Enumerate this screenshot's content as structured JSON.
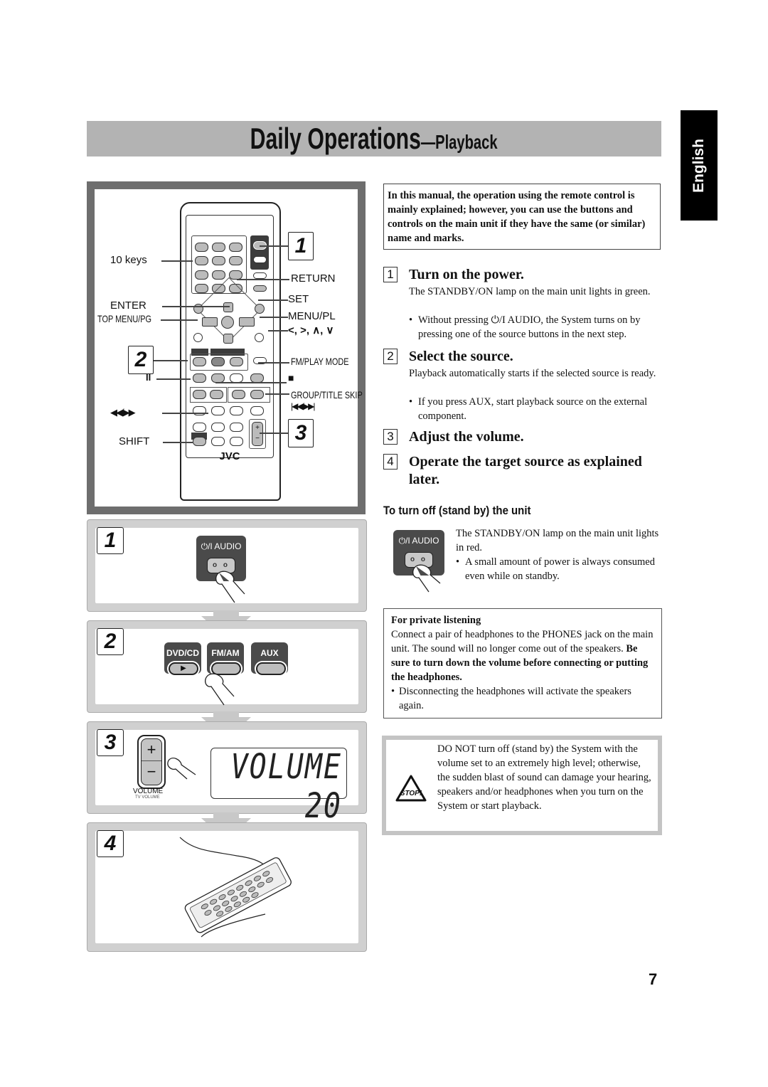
{
  "header": {
    "title_main": "Daily Operations",
    "title_dash": "—",
    "title_sub": "Playback",
    "language_tab": "English"
  },
  "remote_diagram": {
    "brand": "JVC",
    "callouts": {
      "ten_keys": "10 keys",
      "enter": "ENTER",
      "top_menu": "TOP MENU/PG",
      "return": "RETURN",
      "set": "SET",
      "menu_pl": "MENU/PL",
      "cursor": "<, >, ∧, ∨",
      "fm_play_mode": "FM/PLAY MODE",
      "pause": "II",
      "stop": "■",
      "group_title_skip": "GROUP/TITLE SKIP",
      "skip": "|◀◀/▶▶|",
      "search": "◀◀/▶▶",
      "shift": "SHIFT"
    },
    "step_markers": [
      "1",
      "2",
      "3"
    ]
  },
  "step_panels": [
    {
      "number": "1",
      "key_label": "⏻/I AUDIO"
    },
    {
      "number": "2",
      "keys": [
        "DVD/CD",
        "FM/AM",
        "AUX"
      ],
      "play_glyph": "▶"
    },
    {
      "number": "3",
      "volume_label": "VOLUME",
      "tv_volume_label": "TV VOLUME",
      "plus": "+",
      "minus": "−",
      "display_text": "VOLUME 20"
    },
    {
      "number": "4"
    }
  ],
  "intro_note": "In this manual, the operation using the remote control is mainly explained; however, you can use the buttons and controls on the main unit if they have the same (or similar) name and marks.",
  "steps": [
    {
      "number": "1",
      "heading": "Turn on the power.",
      "body": "The STANDBY/ON lamp on the main unit lights in green.",
      "bullets": [
        "Without pressing ⏻/I AUDIO, the System turns on by pressing one of the source buttons in the next step."
      ]
    },
    {
      "number": "2",
      "heading": "Select the source.",
      "body": "Playback automatically starts if the selected source is ready.",
      "bullets": [
        "If you press AUX, start playback source on the external component."
      ]
    },
    {
      "number": "3",
      "heading": "Adjust the volume."
    },
    {
      "number": "4",
      "heading": "Operate the target source as explained later."
    }
  ],
  "turn_off": {
    "heading": "To turn off (stand by) the unit",
    "key_label": "⏻/I AUDIO",
    "body": "The STANDBY/ON lamp on the main unit lights in red.",
    "bullets": [
      "A small amount of power is always consumed even while on standby."
    ]
  },
  "private_listening": {
    "heading": "For private listening",
    "body": "Connect a pair of headphones to the PHONES jack on the main unit. The sound will no longer come out of the speakers.",
    "body_bold": "Be sure to turn down the volume before connecting or putting the headphones.",
    "bullets": [
      "Disconnecting the headphones will activate the speakers again."
    ]
  },
  "caution": {
    "icon_label": "STOP!",
    "text": "DO NOT turn off (stand by) the System with the volume set to an extremely high level; otherwise, the sudden blast of sound can damage your hearing, speakers and/or headphones when you turn on the System or start playback."
  },
  "page_number": "7"
}
